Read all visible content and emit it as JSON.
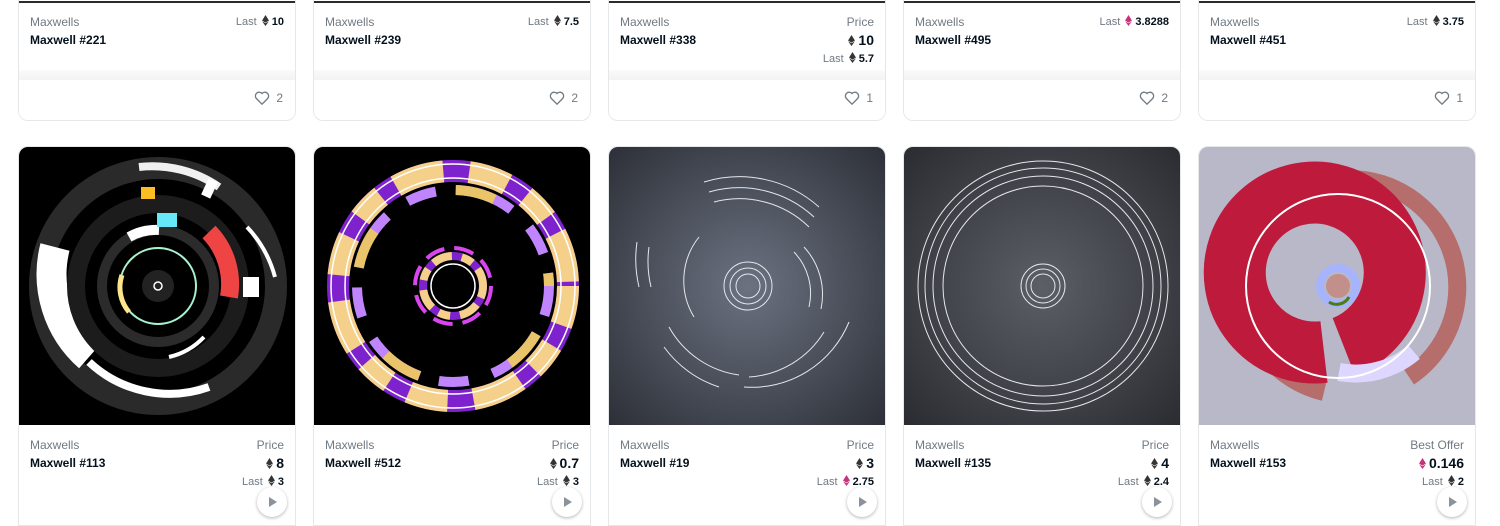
{
  "row1": [
    {
      "collection": "Maxwells",
      "name": "Maxwell #221",
      "label": "Last",
      "value": "10",
      "eth": "black",
      "likes": "2"
    },
    {
      "collection": "Maxwells",
      "name": "Maxwell #239",
      "label": "Last",
      "value": "7.5",
      "eth": "black",
      "likes": "2"
    },
    {
      "collection": "Maxwells",
      "name": "Maxwell #338",
      "label": "Price",
      "value": "10",
      "last_label": "Last",
      "last_value": "5.7",
      "eth": "black",
      "likes": "1"
    },
    {
      "collection": "Maxwells",
      "name": "Maxwell #495",
      "label": "Last",
      "value": "3.8288",
      "eth": "pink",
      "likes": "2"
    },
    {
      "collection": "Maxwells",
      "name": "Maxwell #451",
      "label": "Last",
      "value": "3.75",
      "eth": "black",
      "likes": "1"
    }
  ],
  "row2": [
    {
      "collection": "Maxwells",
      "name": "Maxwell #113",
      "label": "Price",
      "value": "8",
      "last_label": "Last",
      "last_value": "3",
      "last_eth": "black"
    },
    {
      "collection": "Maxwells",
      "name": "Maxwell #512",
      "label": "Price",
      "value": "0.7",
      "last_label": "Last",
      "last_value": "3",
      "last_eth": "black"
    },
    {
      "collection": "Maxwells",
      "name": "Maxwell #19",
      "label": "Price",
      "value": "3",
      "last_label": "Last",
      "last_value": "2.75",
      "last_eth": "pink"
    },
    {
      "collection": "Maxwells",
      "name": "Maxwell #135",
      "label": "Price",
      "value": "4",
      "last_label": "Last",
      "last_value": "2.4",
      "last_eth": "black"
    },
    {
      "collection": "Maxwells",
      "name": "Maxwell #153",
      "label": "Best Offer",
      "value": "0.146",
      "value_eth": "pink",
      "last_label": "Last",
      "last_value": "2",
      "last_eth": "black"
    }
  ],
  "colors": {
    "eth_black": "#343434",
    "eth_pink": "#c7317a",
    "border": "#e5e8eb",
    "muted": "#707a83"
  },
  "icons": {
    "eth": "ethereum-icon",
    "heart": "heart-icon",
    "play": "play-icon"
  }
}
